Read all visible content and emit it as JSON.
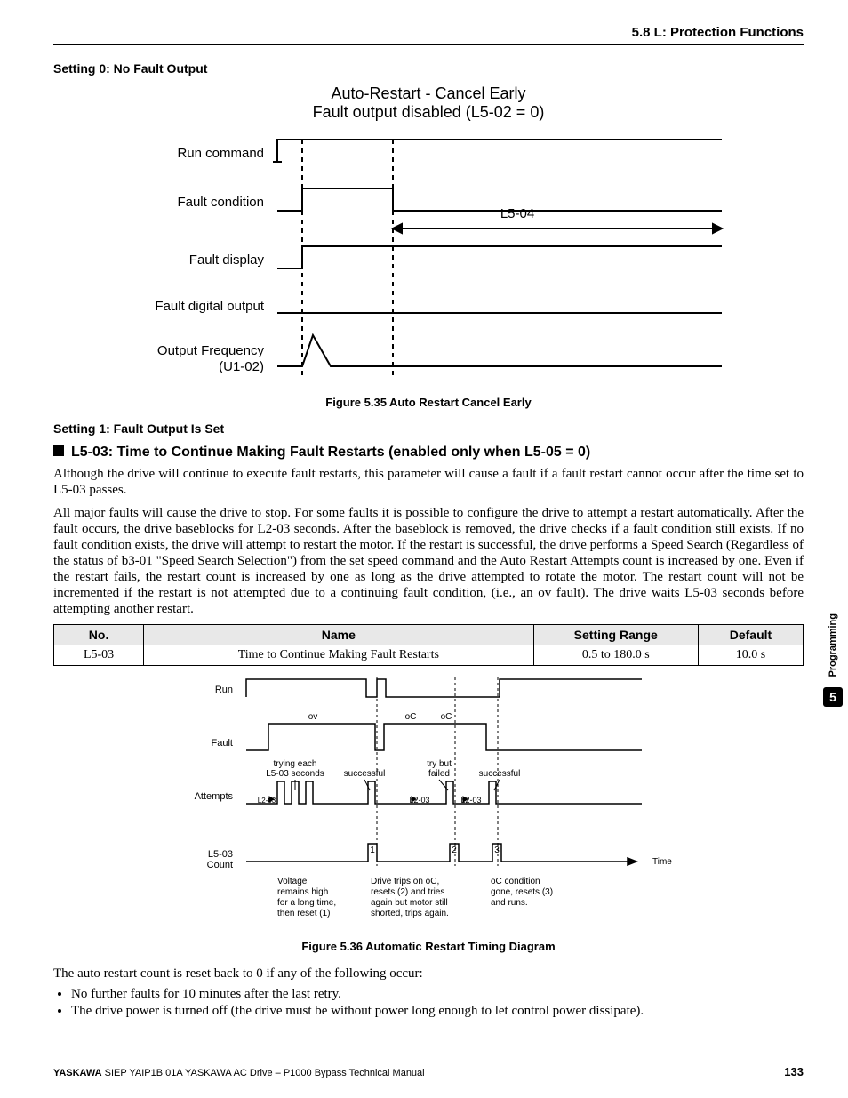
{
  "header": {
    "section": "5.8 L: Protection Functions"
  },
  "subheadings": {
    "s0": "Setting 0: No Fault Output",
    "s1": "Setting 1: Fault Output Is Set"
  },
  "fig1": {
    "title1": "Auto-Restart - Cancel Early",
    "title2": "Fault output disabled (L5-02 = 0)",
    "labels": {
      "run": "Run command",
      "faultCond": "Fault condition",
      "l504": "L5-04",
      "faultDisp": "Fault display",
      "faultOut": "Fault digital output",
      "outFreq1": "Output Frequency",
      "outFreq2": "(U1-02)"
    },
    "caption": "Figure 5.35  Auto Restart Cancel Early"
  },
  "h2": "L5-03: Time to Continue Making Fault Restarts (enabled only when L5-05 = 0)",
  "paragraphs": {
    "p1": "Although the drive will continue to execute fault restarts, this parameter will cause a fault if a fault restart cannot occur after the time set to L5-03 passes.",
    "p2": "All major faults will cause the drive to stop. For some faults it is possible to configure the drive to attempt a restart automatically. After the fault occurs, the drive baseblocks for L2-03 seconds. After the baseblock is removed, the drive checks if a fault condition still exists. If no fault condition exists, the drive will attempt to restart the motor. If the restart is successful, the drive performs a Speed Search (Regardless of the status of b3-01 \"Speed Search Selection\") from the set speed command and the Auto Restart Attempts count is increased by one. Even if the restart fails, the restart count is increased by one as long as the drive attempted to rotate the motor. The restart count will not be incremented if the restart is not attempted due to a continuing fault condition, (i.e., an ov fault). The drive waits L5-03 seconds before attempting another restart."
  },
  "table": {
    "headers": [
      "No.",
      "Name",
      "Setting Range",
      "Default"
    ],
    "row": [
      "L5-03",
      "Time to Continue Making Fault Restarts",
      "0.5 to 180.0 s",
      "10.0 s"
    ]
  },
  "fig2": {
    "labels": {
      "run": "Run",
      "fault": "Fault",
      "attempts": "Attempts",
      "l503count1": "L5-03",
      "l503count2": "Count",
      "ov": "ov",
      "oc": "oC",
      "trying1": "trying each",
      "trying2": "L5-03 seconds",
      "successful": "successful",
      "tryfail1": "try but",
      "tryfail2": "failed",
      "l203": "L2-03",
      "time": "Time",
      "num1": "1",
      "num2": "2",
      "num3": "3",
      "note1a": "Voltage",
      "note1b": "remains high",
      "note1c": "for a long time,",
      "note1d": "then reset (1)",
      "note2a": "Drive trips on oC,",
      "note2b": "resets (2) and tries",
      "note2c": "again but motor still",
      "note2d": "shorted, trips again.",
      "note3a": "oC condition",
      "note3b": "gone, resets (3)",
      "note3c": "and runs."
    },
    "caption": "Figure 5.36  Automatic Restart Timing Diagram"
  },
  "afterFig2": "The auto restart count is reset back to 0 if any of the following occur:",
  "bullets": [
    "No further faults for 10 minutes after the last retry.",
    "The drive power is turned off (the drive must be without power long enough to let control power dissipate)."
  ],
  "footer": {
    "brand": "YASKAWA",
    "rest": " SIEP YAIP1B 01A YASKAWA AC Drive – P1000 Bypass Technical Manual",
    "page": "133"
  },
  "sidetab": {
    "label": "Programming",
    "num": "5"
  }
}
